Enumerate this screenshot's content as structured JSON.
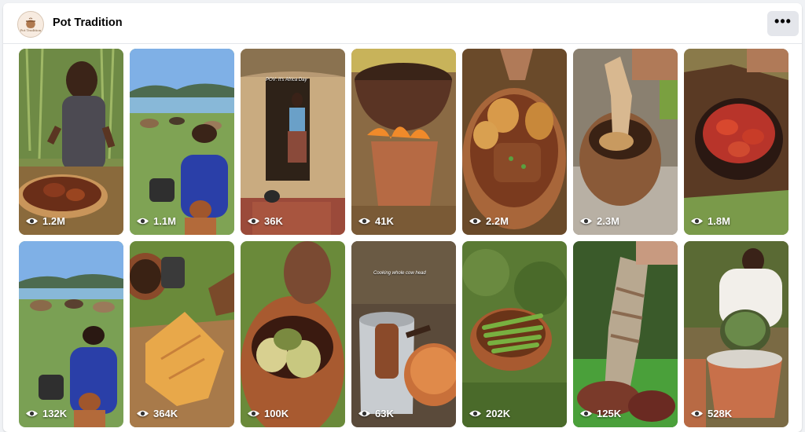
{
  "header": {
    "page_name": "Pot Tradition",
    "avatar_text": "Pot Tradition",
    "more_label": "•••"
  },
  "reels": [
    {
      "views": "1.2M",
      "icon": "eye-icon"
    },
    {
      "views": "1.1M",
      "icon": "eye-icon"
    },
    {
      "views": "36K",
      "icon": "eye-icon",
      "caption": "POV: It's Africa Day"
    },
    {
      "views": "41K",
      "icon": "eye-icon"
    },
    {
      "views": "2.2M",
      "icon": "eye-icon"
    },
    {
      "views": "2.3M",
      "icon": "eye-icon"
    },
    {
      "views": "1.8M",
      "icon": "eye-icon"
    },
    {
      "views": "132K",
      "icon": "eye-icon"
    },
    {
      "views": "364K",
      "icon": "eye-icon"
    },
    {
      "views": "100K",
      "icon": "eye-icon"
    },
    {
      "views": "63K",
      "icon": "eye-icon",
      "caption": "Cooking whole cow head"
    },
    {
      "views": "202K",
      "icon": "eye-icon"
    },
    {
      "views": "125K",
      "icon": "eye-icon"
    },
    {
      "views": "528K",
      "icon": "eye-icon"
    }
  ],
  "colors": {
    "header_button_bg": "#e4e6eb",
    "page_bg": "#f0f2f5"
  }
}
